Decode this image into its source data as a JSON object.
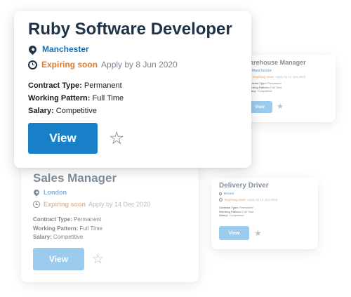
{
  "jobs": [
    {
      "title": "Ruby Software Developer",
      "location": "Manchester",
      "expiring_label": "Expiring soon",
      "apply_by": "Apply by 8 Jun 2020",
      "contract_type_label": "Contract Type:",
      "contract_type": "Permanent",
      "working_pattern_label": "Working Pattern:",
      "working_pattern": "Full Time",
      "salary_label": "Salary:",
      "salary": "Competitive",
      "view_label": "View",
      "star_glyph": "☆"
    },
    {
      "title": "Warehouse Manager",
      "location": "Manchester",
      "expiring_label": "Expiring soon",
      "apply_by": "Apply by 12 Jun 2020",
      "contract_type_label": "Contract Type:",
      "contract_type": "Permanent",
      "working_pattern_label": "Working Pattern:",
      "working_pattern": "Full Time",
      "salary_label": "Salary:",
      "salary": "Competitive",
      "view_label": "View",
      "star_glyph": "★"
    },
    {
      "title": "Sales Manager",
      "location": "London",
      "expiring_label": "Expiring soon",
      "apply_by": "Apply by 14 Dec 2020",
      "contract_type_label": "Contract Type:",
      "contract_type": "Permanent",
      "working_pattern_label": "Working Pattern:",
      "working_pattern": "Full Time",
      "salary_label": "Salary:",
      "salary": "Competitive",
      "view_label": "View",
      "star_glyph": "☆"
    },
    {
      "title": "Delivery Driver",
      "location": "Bristol",
      "expiring_label": "Expiring soon",
      "apply_by": "Apply by 12 Jun 2020",
      "contract_type_label": "Contract Type:",
      "contract_type": "Permanent",
      "working_pattern_label": "Working Pattern:",
      "working_pattern": "Full Time",
      "salary_label": "Salary:",
      "salary": "Competitive",
      "view_label": "View",
      "star_glyph": "★"
    }
  ]
}
